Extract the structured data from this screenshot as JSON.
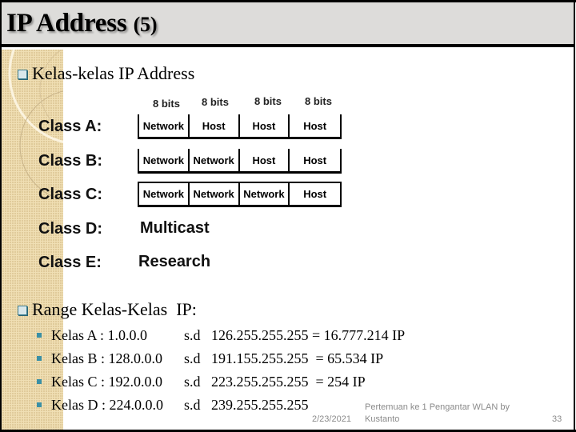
{
  "slide": {
    "title": "IP Address",
    "title_number": "(5)"
  },
  "section1": {
    "heading": "Kelas-kelas IP Address",
    "bits_labels": [
      "8 bits",
      "8 bits",
      "8 bits",
      "8 bits"
    ],
    "classes": [
      {
        "label": "Class A:",
        "cells": [
          "Network",
          "Host",
          "Host",
          "Host"
        ]
      },
      {
        "label": "Class B:",
        "cells": [
          "Network",
          "Network",
          "Host",
          "Host"
        ]
      },
      {
        "label": "Class C:",
        "cells": [
          "Network",
          "Network",
          "Network",
          "Host"
        ]
      },
      {
        "label": "Class D:",
        "text": "Multicast"
      },
      {
        "label": "Class E:",
        "text": "Research"
      }
    ]
  },
  "section2": {
    "heading": "Range Kelas-Kelas  IP:",
    "ranges": [
      {
        "name": "Kelas A : 1.0.0.0",
        "sep": "s.d",
        "end": "126.255.255.255 = 16.777.214 IP"
      },
      {
        "name": "Kelas B : 128.0.0.0",
        "sep": "s.d",
        "end": "191.155.255.255  = 65.534 IP"
      },
      {
        "name": "Kelas C : 192.0.0.0",
        "sep": "s.d",
        "end": "223.255.255.255  = 254 IP"
      },
      {
        "name": "Kelas D : 224.0.0.0",
        "sep": "s.d",
        "end": "239.255.255.255"
      }
    ]
  },
  "footer": {
    "date": "2/23/2021",
    "course_line1": "Pertemuan ke 1 Pengantar WLAN by",
    "course_line2": "Kustanto",
    "page_number": "33"
  }
}
